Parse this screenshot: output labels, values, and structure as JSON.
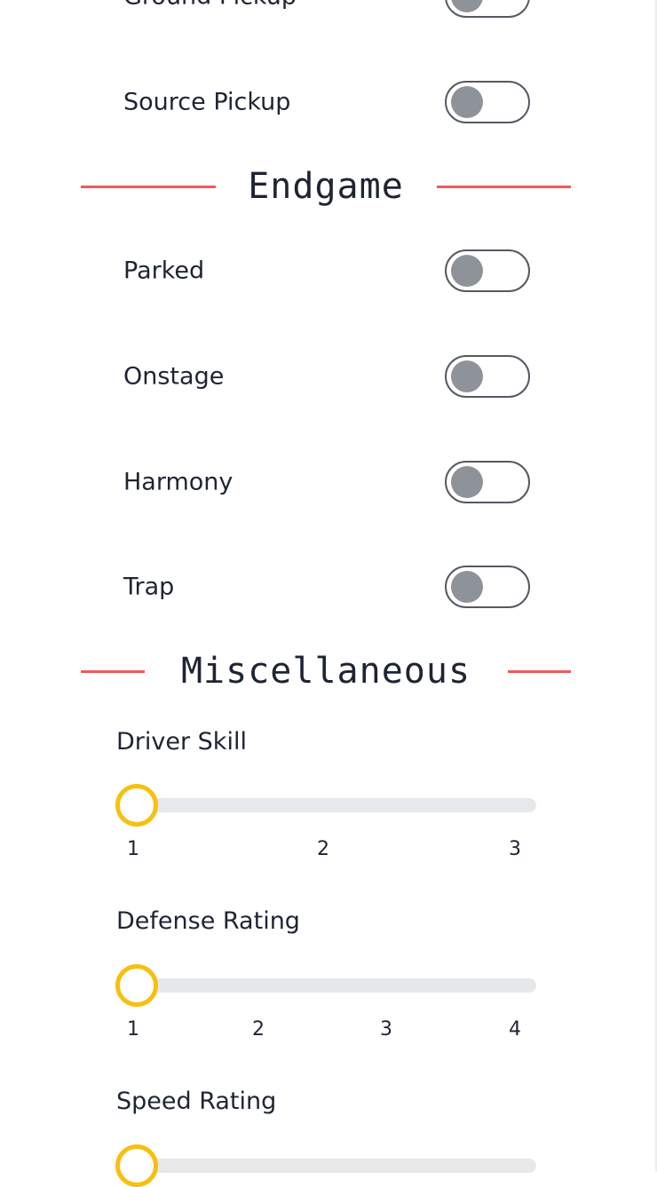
{
  "toggles_top": [
    {
      "label": "Ground Pickup",
      "on": false
    },
    {
      "label": "Source Pickup",
      "on": false
    }
  ],
  "endgame": {
    "title": "Endgame",
    "toggles": [
      {
        "label": "Parked",
        "on": false
      },
      {
        "label": "Onstage",
        "on": false
      },
      {
        "label": "Harmony",
        "on": false
      },
      {
        "label": "Trap",
        "on": false
      }
    ]
  },
  "misc": {
    "title": "Miscellaneous",
    "sliders": [
      {
        "label": "Driver Skill",
        "ticks": [
          "1",
          "2",
          "3"
        ],
        "value": 1
      },
      {
        "label": "Defense Rating",
        "ticks": [
          "1",
          "2",
          "3",
          "4"
        ],
        "value": 1
      },
      {
        "label": "Speed Rating",
        "value": 1
      }
    ]
  },
  "colors": {
    "accent_line": "#ef5b5b",
    "slider_thumb": "#f7c010",
    "toggle_knob_off": "#8e9299",
    "text": "#1e2433"
  }
}
